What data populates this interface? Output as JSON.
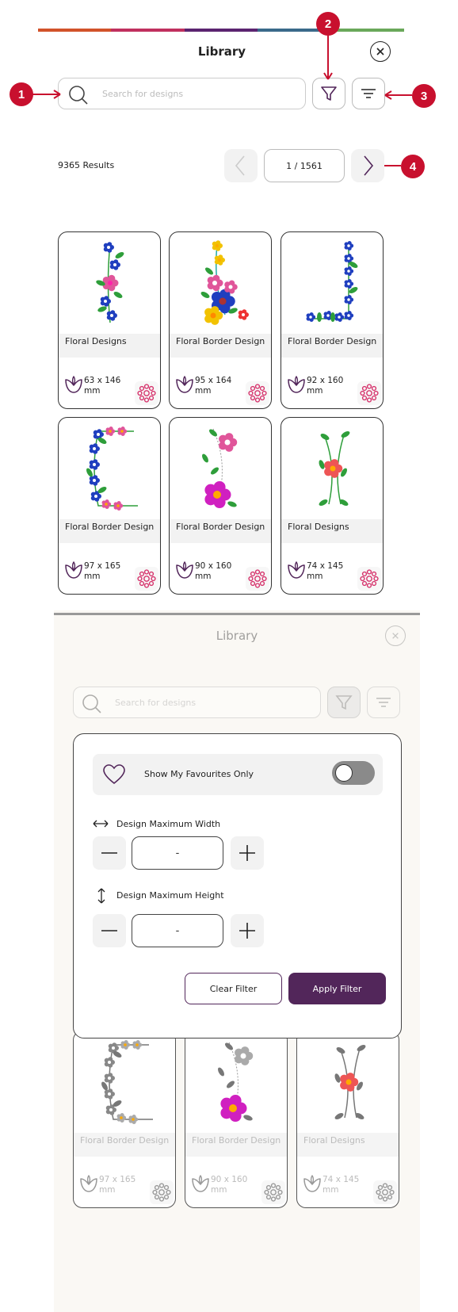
{
  "header": {
    "title": "Library",
    "close_icon": "close-icon",
    "color_bar": [
      "#d2522a",
      "#c0305e",
      "#5b2470",
      "#3a6a8a",
      "#6aa85a"
    ]
  },
  "search": {
    "placeholder": "Search for designs"
  },
  "callouts": {
    "c1": "1",
    "c2": "2",
    "c3": "3",
    "c4": "4"
  },
  "results": {
    "count_text": "9365 Results",
    "page_value": "1 / 1561"
  },
  "cards": [
    {
      "name": "Floral Designs",
      "size": "63 x 146 mm"
    },
    {
      "name": "Floral Border Design",
      "size": "95 x 164 mm"
    },
    {
      "name": "Floral Border Design",
      "size": "92 x 160 mm"
    },
    {
      "name": "Floral Border Design",
      "size": "97 x 165 mm"
    },
    {
      "name": "Floral Border Design",
      "size": "90 x 160 mm"
    },
    {
      "name": "Floral Designs",
      "size": "74 x 145 mm"
    }
  ],
  "filter_view": {
    "title": "Library",
    "search_placeholder": "Search for designs",
    "favourites_label": "Show My Favourites Only",
    "width_label": "Design Maximum Width",
    "width_value": "-",
    "height_label": "Design Maximum Height",
    "height_value": "-",
    "clear_label": "Clear Filter",
    "apply_label": "Apply Filter",
    "cards": [
      {
        "name": "Floral Border Design",
        "size": "97 x 165 mm"
      },
      {
        "name": "Floral Border Design",
        "size": "90 x 160 mm"
      },
      {
        "name": "Floral Designs",
        "size": "74 x 145 mm"
      }
    ]
  },
  "colors": {
    "accent": "#52265a",
    "callout": "#c8102e",
    "gear": "#d6336c"
  }
}
